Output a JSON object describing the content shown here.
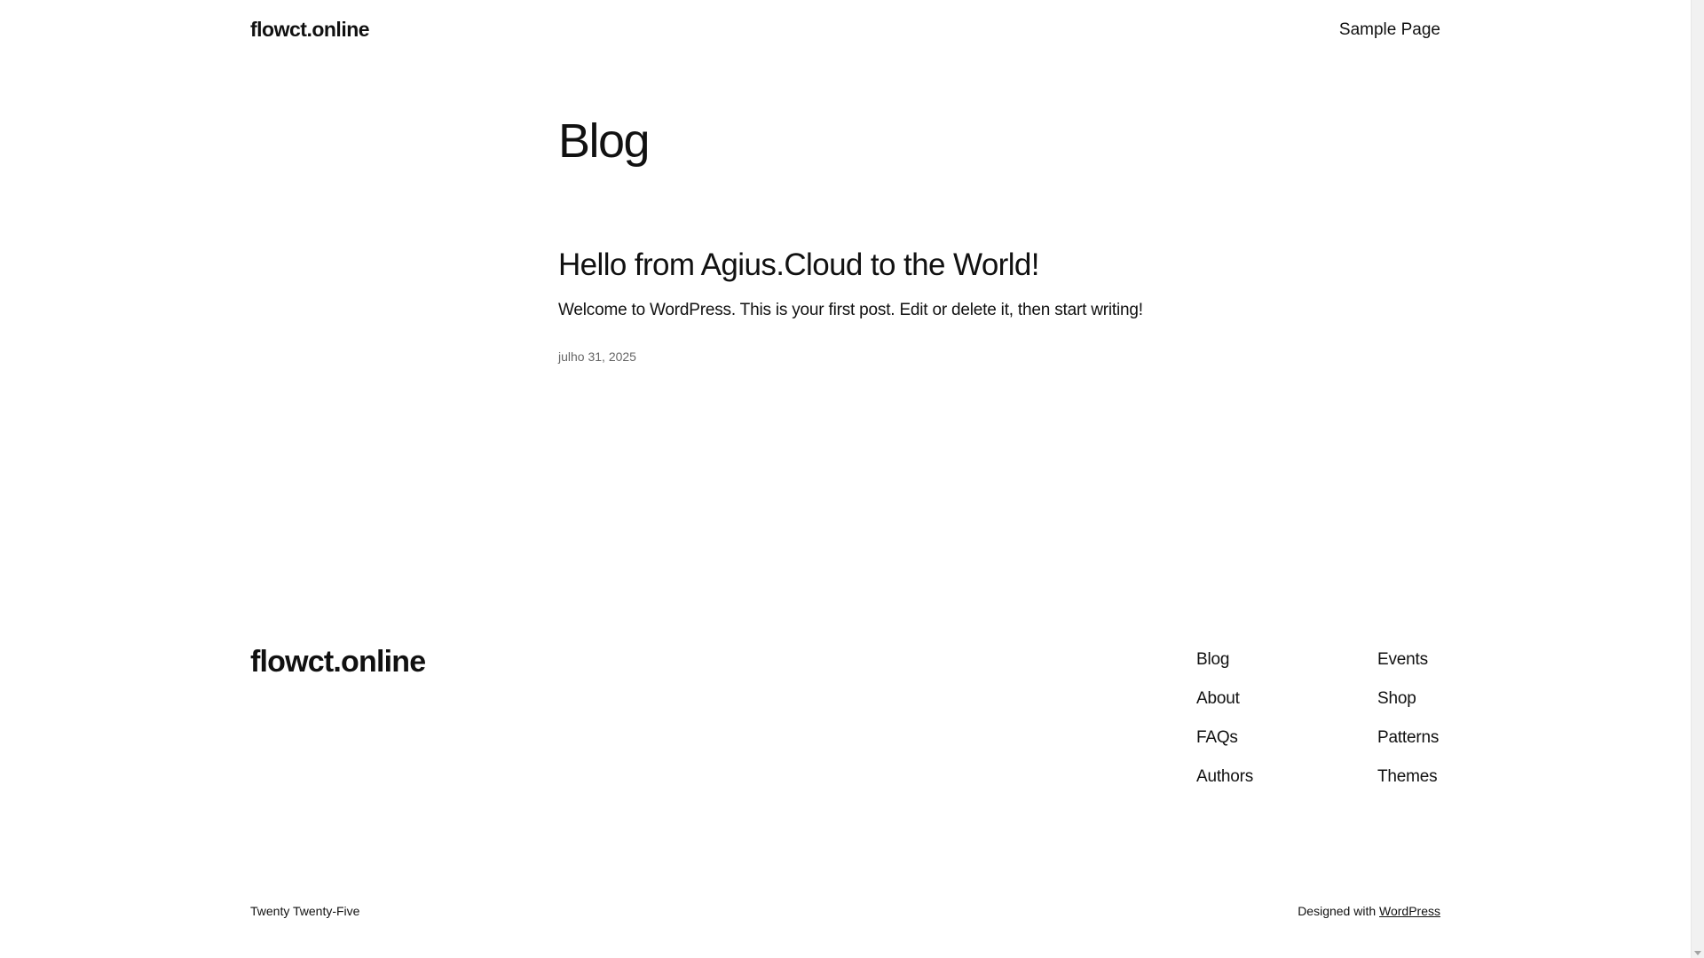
{
  "header": {
    "site_title": "flowct.online",
    "nav_link": "Sample Page"
  },
  "main": {
    "heading": "Blog",
    "posts": [
      {
        "title": "Hello from Agius.Cloud to the World!",
        "excerpt": "Welcome to WordPress. This is your first post. Edit or delete it, then start writing!",
        "date": "julho 31, 2025"
      }
    ]
  },
  "footer": {
    "site_title": "flowct.online",
    "col1": [
      "Blog",
      "About",
      "FAQs",
      "Authors"
    ],
    "col2": [
      "Events",
      "Shop",
      "Patterns",
      "Themes"
    ],
    "theme_credit": "Twenty Twenty-Five",
    "designed_with": "Designed with",
    "designed_with_link": "WordPress"
  }
}
